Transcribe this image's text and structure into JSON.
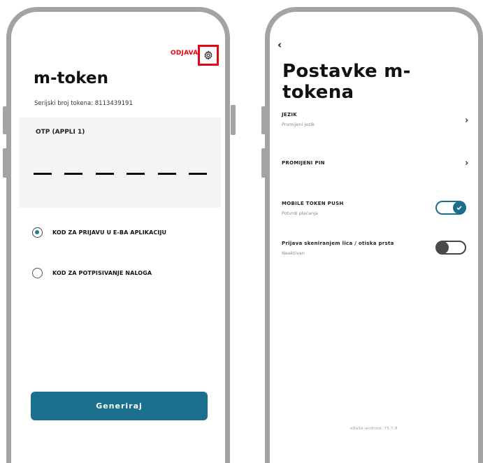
{
  "left": {
    "logout_label": "ODJAVA",
    "title": "m-token",
    "serial_label": "Serijski broj tokena: 8113439191",
    "otp_label": "OTP (APPLI 1)",
    "otp_digits": [
      "",
      "",
      "",
      "",
      "",
      ""
    ],
    "options": [
      {
        "label": "KOD ZA PRIJAVU U E-BA APLIKACIJU",
        "selected": true
      },
      {
        "label": "KOD ZA POTPISIVANJE NALOGA",
        "selected": false
      }
    ],
    "generate_label": "Generiraj",
    "icons": {
      "settings": "gear-icon"
    },
    "colors": {
      "accent": "#1a6f8c",
      "highlight": "#e30613"
    }
  },
  "right": {
    "back_glyph": "‹",
    "title": "Postavke m-tokena",
    "items": [
      {
        "title": "JEZIK",
        "subtitle": "Promijeni jezik",
        "control": "chevron"
      },
      {
        "title": "PROMIJENI PIN",
        "subtitle": "",
        "control": "chevron"
      },
      {
        "title": "MOBILE TOKEN PUSH",
        "subtitle": "Potvrdi plaćanja",
        "control": "toggle",
        "on": true
      },
      {
        "title": "Prijava skeniranjem lica / otiska prsta",
        "subtitle": "Neaktivan",
        "control": "toggle",
        "on": false
      }
    ],
    "footer": "eBaSe-android: 75.7.8"
  }
}
